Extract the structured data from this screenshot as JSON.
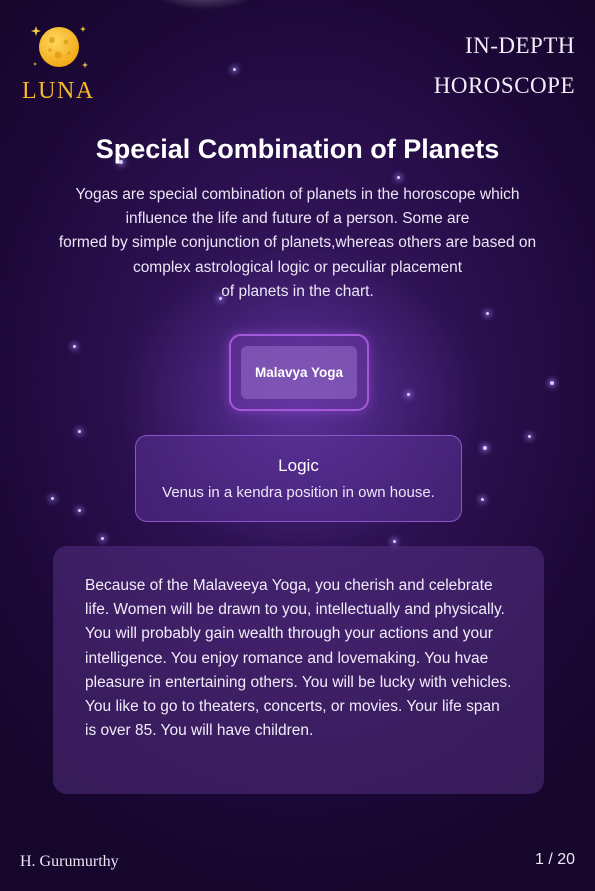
{
  "brand": {
    "name": "LUNA",
    "logo_icon": "moon-icon",
    "accent_color": "#f5b826"
  },
  "header": {
    "title_line1": "IN-DEPTH",
    "title_line2": "HOROSCOPE"
  },
  "page_title": "Special Combination of Planets",
  "intro_lines": [
    "Yogas are special combination of planets in the horoscope which",
    "influence the life and future of a person. Some are",
    "formed by simple conjunction of planets,whereas others are based on",
    "complex astrological logic or peculiar placement",
    "of planets in the chart."
  ],
  "yoga": {
    "name": "Malavya Yoga"
  },
  "logic": {
    "title": "Logic",
    "text": "Venus in a kendra position in own house."
  },
  "description": "Because of the Malaveeya Yoga, you cherish and celebrate life. Women will be drawn to you, intellectually and physically. You will probably gain wealth through your actions and your intelligence. You enjoy romance and lovemaking. You hvae pleasure in entertaining others. You will be lucky with vehicles. You like to go to theaters, concerts, or movies. Your life span is over 85. You will have children.",
  "footer": {
    "author": "H. Gurumurthy",
    "page_indicator": "1 / 20"
  }
}
